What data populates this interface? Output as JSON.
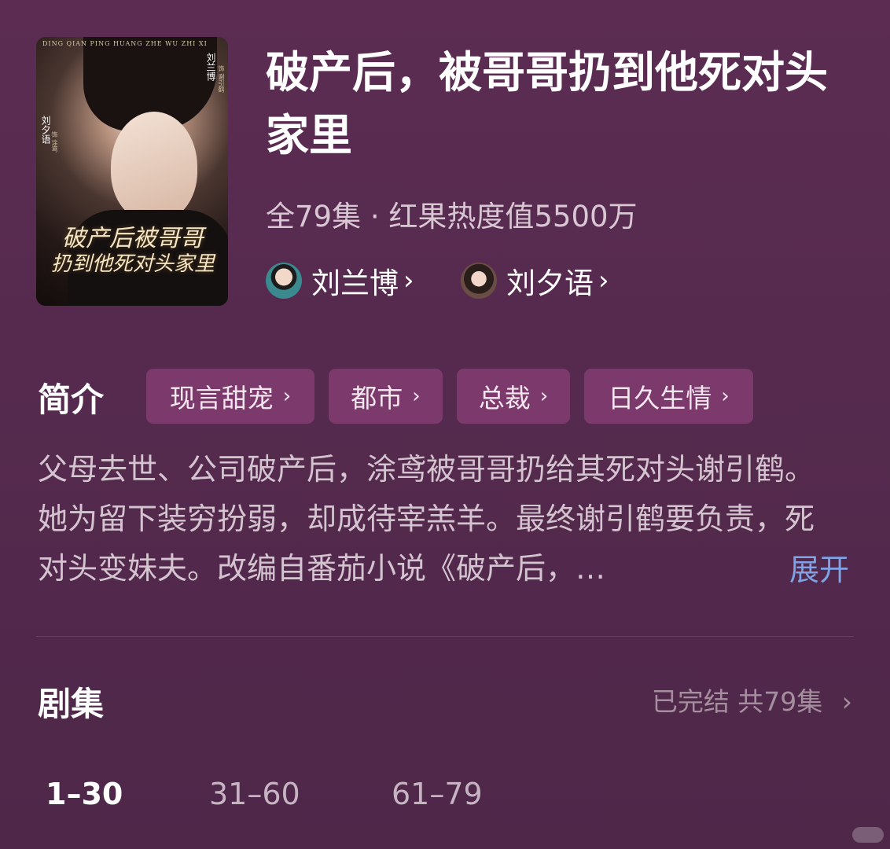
{
  "poster": {
    "tagline": "DING QIAN PING HUANG ZHE WU ZHI XI",
    "cast": [
      {
        "name": "刘兰博",
        "role": "饰 谢引鹤"
      },
      {
        "name": "刘夕语",
        "role": "饰 涂鸢"
      }
    ],
    "title_line1": "破产后被哥哥",
    "title_line2": "扔到他死对头家里"
  },
  "show": {
    "title": "破产后，被哥哥扔到他死对头家里",
    "meta": "全79集 · 红果热度值5500万",
    "actors": [
      {
        "name": "刘兰博",
        "chevron": "›",
        "avatar_color": "#3a8a8f"
      },
      {
        "name": "刘夕语",
        "chevron": "›",
        "avatar_color": "#6a4e45"
      }
    ]
  },
  "intro": {
    "label": "简介",
    "tags": [
      {
        "label": "现言甜宠",
        "chevron": "›"
      },
      {
        "label": "都市",
        "chevron": "›"
      },
      {
        "label": "总裁",
        "chevron": "›"
      },
      {
        "label": "日久生情",
        "chevron": "›"
      }
    ],
    "description": "父母去世、公司破产后，涂鸢被哥哥扔给其死对头谢引鹤。她为留下装穷扮弱，却成待宰羔羊。最终谢引鹤要负责，死对头变妹夫。改编自番茄小说《破产后，…",
    "expand": "展开"
  },
  "episodes": {
    "label": "剧集",
    "status": "已完结 共79集",
    "status_chevron": "›",
    "ranges": [
      {
        "label": "1–30",
        "active": true
      },
      {
        "label": "31–60",
        "active": false
      },
      {
        "label": "61–79",
        "active": false
      }
    ]
  },
  "colors": {
    "background": "#552a4e",
    "tag_bg": "#7c3a6c",
    "expand": "#7fa3e4",
    "status": "#a58f9f"
  }
}
